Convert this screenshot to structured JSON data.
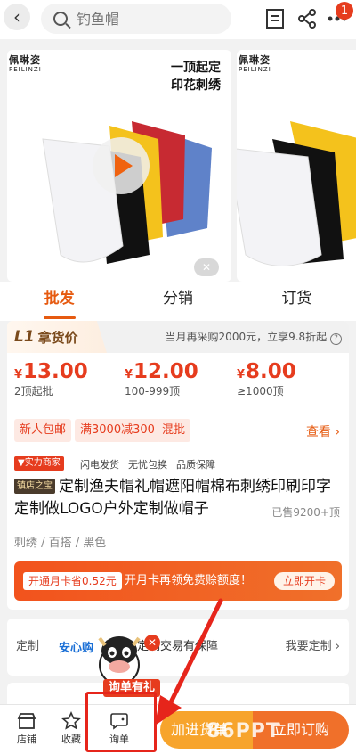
{
  "header": {
    "search_placeholder": "钓鱼帽",
    "notification_count": "1"
  },
  "gallery": {
    "brand_cn": "佩琳姿",
    "brand_en": "PEILINZI",
    "promo_line1": "一顶起定",
    "promo_line2": "印花刺绣",
    "second_brand_cn": "佩琳姿",
    "second_brand_en": "PEILINZI"
  },
  "tabs": [
    {
      "label": "批发",
      "active": true
    },
    {
      "label": "分销",
      "active": false
    },
    {
      "label": "订货",
      "active": false
    }
  ],
  "pricing": {
    "level_badge": "L1",
    "level_title": "拿货价",
    "tip": "当月再采购2000元，立享9.8折起",
    "currency": "¥",
    "tiers": [
      {
        "price": "13.00",
        "qty": "2顶起批"
      },
      {
        "price": "12.00",
        "qty": "100-999顶"
      },
      {
        "price": "8.00",
        "qty": "≥1000顶"
      }
    ],
    "tags": [
      "新人包邮",
      "满3000减300",
      "混批"
    ],
    "see_more": "查看"
  },
  "services": {
    "merchant_badge": "实力商家",
    "items": [
      "闪电发货",
      "无忧包换",
      "品质保障"
    ]
  },
  "product": {
    "shop_badge": "镇店之宝",
    "title": "定制渔夫帽礼帽遮阳帽棉布刺绣印刷印字定制做LOGO户外定制做帽子",
    "sold": "已售9200+顶",
    "attributes": "刺绣 / 百搭 / 黑色"
  },
  "member": {
    "saving": "开通月卡省0.52元",
    "text": "开月卡再领免费赊额度！",
    "button": "立即开卡"
  },
  "customization": {
    "label": "定制",
    "brand": "安心购",
    "text": "定制交易有保障",
    "right": "我要定制"
  },
  "mascot": {
    "promo": "询单有礼"
  },
  "bottom_bar": {
    "shop": "店铺",
    "favorite": "收藏",
    "inquiry": "询单",
    "add_cart": "加进货单",
    "buy_now": "立即订购"
  },
  "watermark": "86PPT",
  "colors": {
    "accent": "#e65a10",
    "price_red": "#e63c1e",
    "add_cart": "#f7a42c",
    "buy_now": "#f0702a"
  }
}
